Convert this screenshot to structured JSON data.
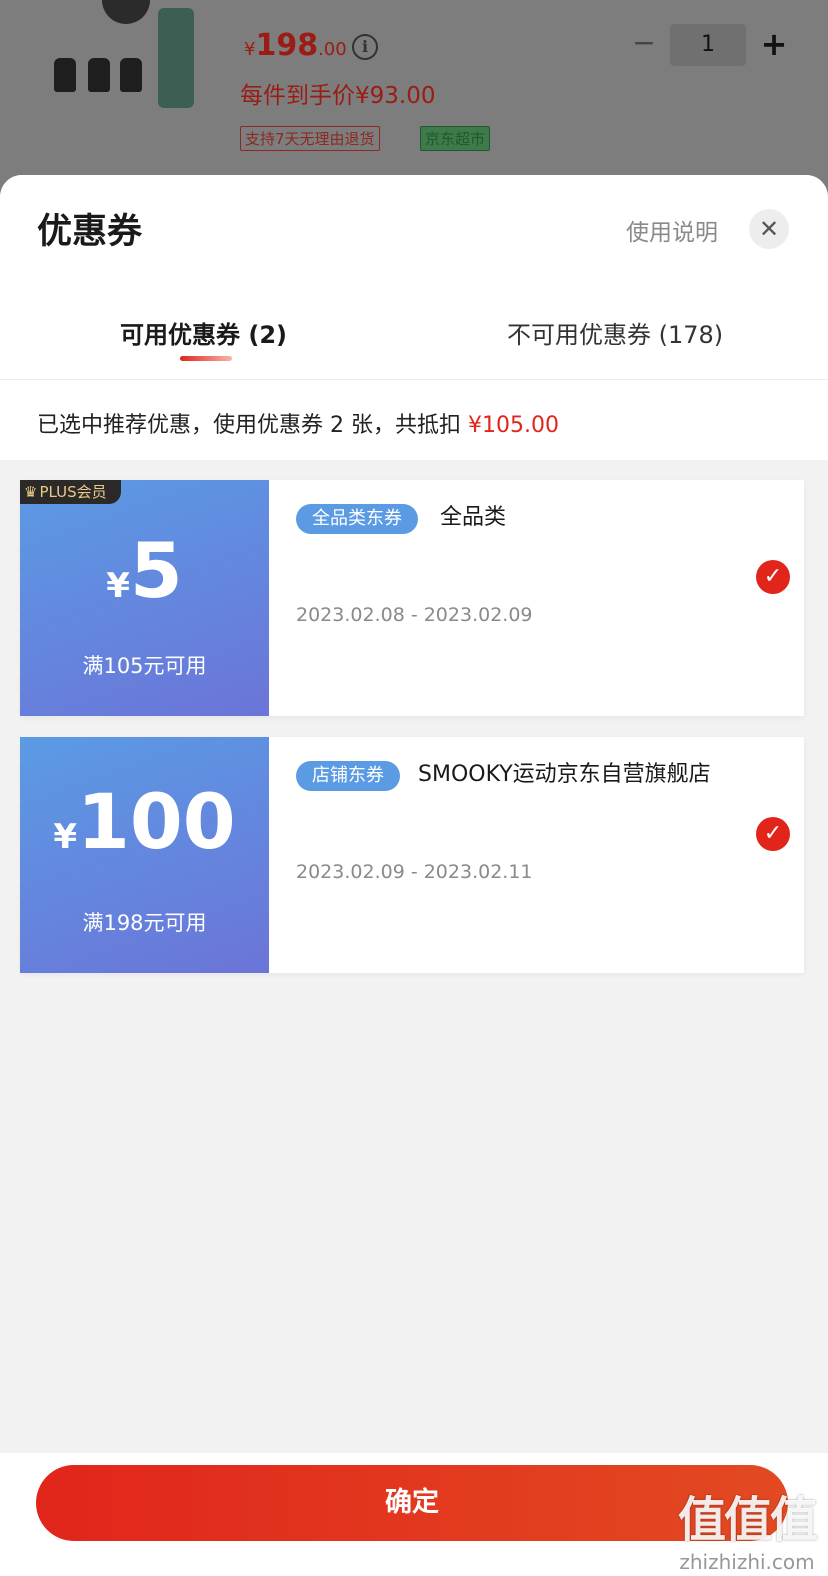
{
  "product": {
    "price_symbol": "¥",
    "price_int": "198",
    "price_dec": ".00",
    "info_glyph": "i",
    "per_item_price": "每件到手价¥93.00",
    "tag_return": "支持7天无理由退货",
    "tag_store": "京东超市",
    "quantity": "1",
    "qty_minus": "−",
    "qty_plus": "+"
  },
  "sheet": {
    "title": "优惠券",
    "usage_link": "使用说明",
    "close_glyph": "✕",
    "tabs": [
      {
        "label": "可用优惠券 (2)",
        "active": true
      },
      {
        "label": "不可用优惠券 (178)",
        "active": false
      }
    ],
    "summary_text": "已选中推荐优惠，使用优惠券 2 张，共抵扣 ",
    "summary_amount": "¥105.00"
  },
  "coupons": [
    {
      "badge": "PLUS会员",
      "badge_icon": "crown-icon",
      "currency": "¥",
      "amount": "5",
      "condition": "满105元可用",
      "tag": "全品类东券",
      "name": "全品类",
      "date_range": "2023.02.08 - 2023.02.09",
      "selected": true,
      "check_glyph": "✓"
    },
    {
      "badge": "",
      "currency": "¥",
      "amount": "100",
      "condition": "满198元可用",
      "tag": "店铺东券",
      "name": "SMOOKY运动京东自营旗舰店",
      "date_range": "2023.02.09 - 2023.02.11",
      "selected": true,
      "check_glyph": "✓"
    }
  ],
  "footer": {
    "confirm_label": "确定"
  },
  "watermark": {
    "mark": "值值值",
    "site": "zhizhizhi.com"
  },
  "colors": {
    "accent_red": "#e1251b",
    "coupon_blue": "#5b9be4",
    "coupon_purple": "#6b74d8",
    "plus_gold": "#e9c98a"
  }
}
